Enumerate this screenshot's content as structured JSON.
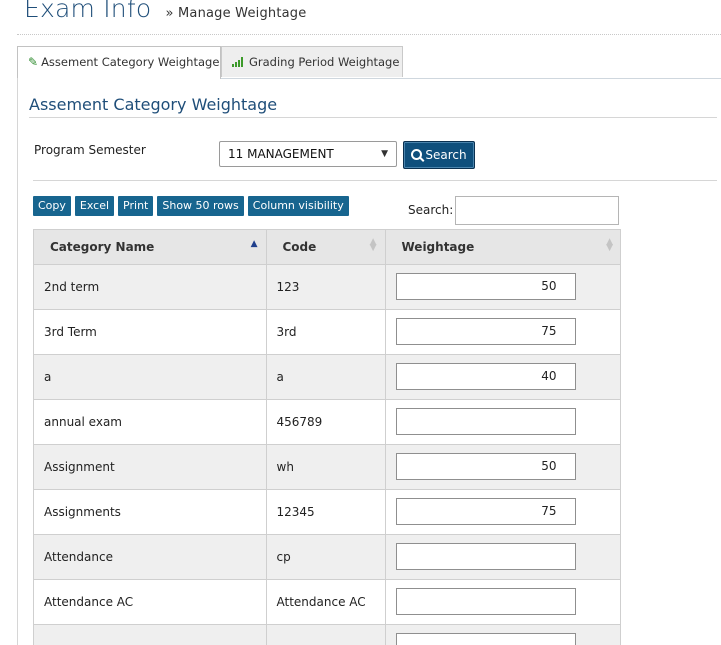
{
  "page": {
    "title": "Exam Info",
    "breadcrumb_sep": "»",
    "breadcrumb": "Manage Weightage"
  },
  "tabs": [
    {
      "label": "Assement Category Weightage",
      "icon": "paperclip-icon",
      "active": true
    },
    {
      "label": "Grading Period Weightage",
      "icon": "bar-chart-icon",
      "active": false
    }
  ],
  "section": {
    "title": "Assement Category Weightage",
    "field_label": "Program Semester",
    "selected_program": "11 MANAGEMENT",
    "search_button": "Search"
  },
  "toolbar": {
    "buttons": [
      "Copy",
      "Excel",
      "Print",
      "Show 50 rows",
      "Column visibility"
    ],
    "search_label": "Search:",
    "search_value": ""
  },
  "table": {
    "headers": [
      "Category Name",
      "Code",
      "Weightage"
    ],
    "rows": [
      {
        "name": "2nd term",
        "code": "123",
        "weightage": "50"
      },
      {
        "name": "3rd Term",
        "code": "3rd",
        "weightage": "75"
      },
      {
        "name": "a",
        "code": "a",
        "weightage": "40"
      },
      {
        "name": "annual exam",
        "code": "456789",
        "weightage": ""
      },
      {
        "name": "Assignment",
        "code": "wh",
        "weightage": "50"
      },
      {
        "name": "Assignments",
        "code": "12345",
        "weightage": "75"
      },
      {
        "name": "Attendance",
        "code": "cp",
        "weightage": ""
      },
      {
        "name": "Attendance AC",
        "code": "Attendance AC",
        "weightage": ""
      },
      {
        "name": "",
        "code": "",
        "weightage": ""
      }
    ]
  },
  "colors": {
    "primary": "#1f4e79",
    "button_dark": "#0f4f7c",
    "toolbar_button": "#17658f",
    "icon_green": "#3c9a2a"
  }
}
